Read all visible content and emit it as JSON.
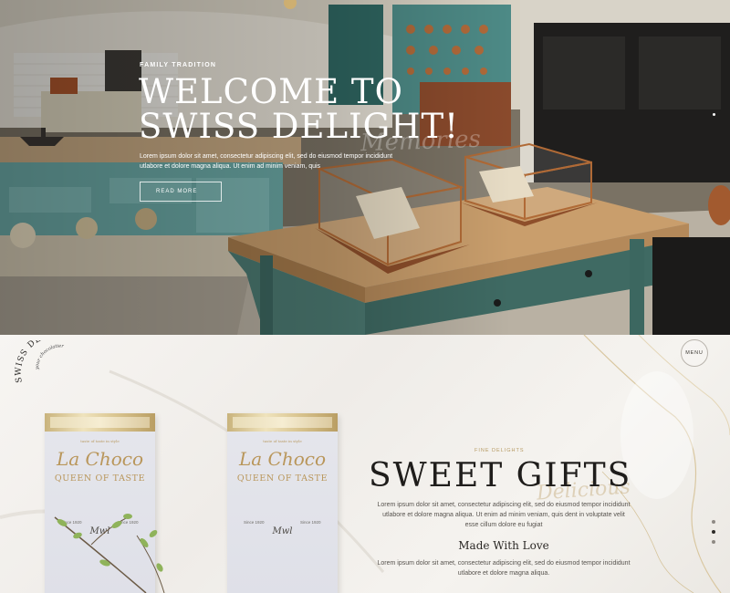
{
  "hero": {
    "kicker": "FAMILY TRADITION",
    "title_line1": "WELCOME TO",
    "title_line2": "SWISS DELIGHT!",
    "script_word": "Memories",
    "text": "Lorem ipsum dolor sit amet, consectetur adipiscing elit, sed do eiusmod tempor incididunt utlabore et dolore magna aliqua. Ut enim ad minim veniam, quis",
    "button_label": "READ MORE"
  },
  "header": {
    "logo_top": "your chocolatier",
    "logo_main": "SWISS DELIGHT",
    "menu_label": "MENU"
  },
  "products": [
    {
      "tiny": "taste of taste in style",
      "brand": "La Choco",
      "queen": "QUEEN OF TASTE",
      "since_left": "Since 1920",
      "since_right": "Since 1920",
      "sign": "Mwl"
    },
    {
      "tiny": "taste of taste in style",
      "brand": "La Choco",
      "queen": "QUEEN OF TASTE",
      "since_left": "Since 1920",
      "since_right": "Since 1920",
      "sign": "Mwl"
    }
  ],
  "section": {
    "kicker": "FINE DELIGHTS",
    "title": "SWEET GIFTS",
    "script_word": "Delicious",
    "text": "Lorem ipsum dolor sit amet, consectetur adipiscing elit, sed do eiusmod tempor incididunt utlabore et dolore magna aliqua. Ut enim ad minim veniam, quis dent in voluptate velit esse cillum dolore eu fugiat",
    "subtitle": "Made With Love",
    "text2": "Lorem ipsum dolor sit amet, consectetur adipiscing elit, sed do eiusmod tempor incididunt utlabore et dolore magna aliqua."
  },
  "colors": {
    "accent_gold": "#b69a63",
    "dark_text": "#1f1d1b",
    "hero_overlay_text": "#ffffff"
  },
  "icons": {
    "hero_slider_dots": "dot-icon",
    "section_slider_dots": "dot-icon"
  }
}
